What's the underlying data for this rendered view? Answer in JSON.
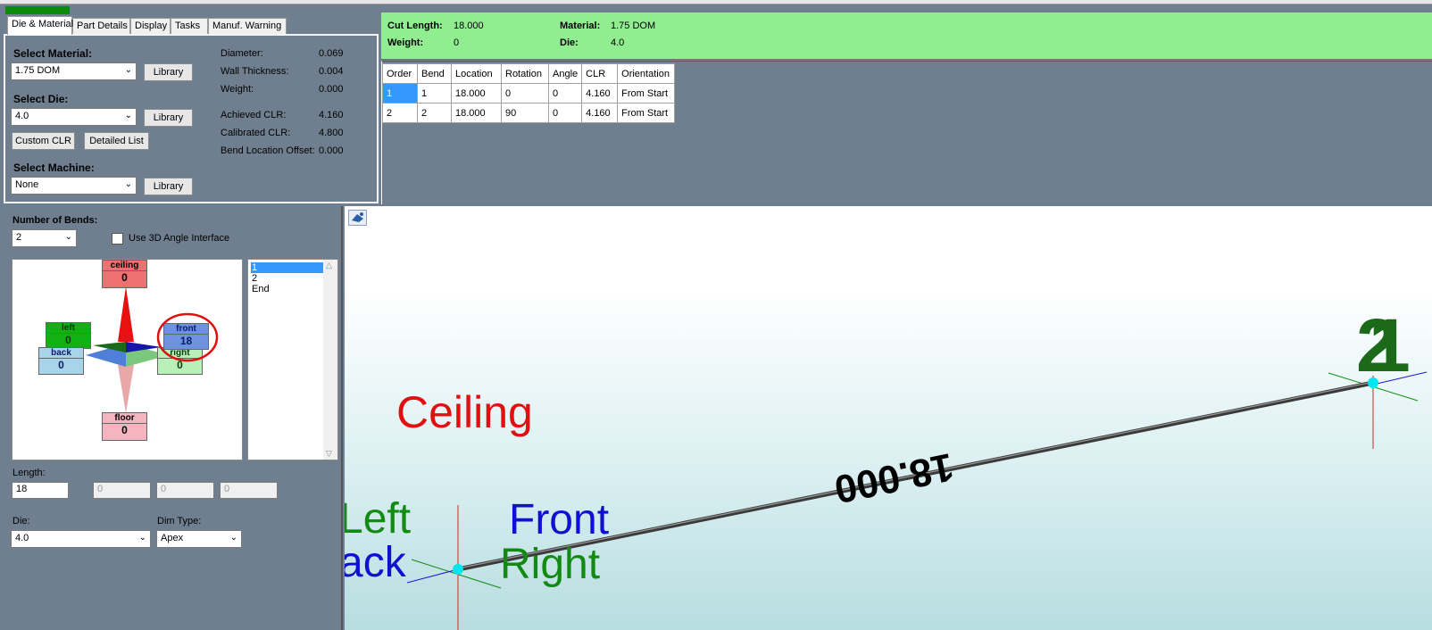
{
  "tabs": [
    {
      "label": "Die & Material"
    },
    {
      "label": "Part Details"
    },
    {
      "label": "Display"
    },
    {
      "label": "Tasks"
    },
    {
      "label": "Manuf. Warning"
    }
  ],
  "material": {
    "select_material_label": "Select Material:",
    "material_value": "1.75 DOM",
    "library_label": "Library",
    "select_die_label": "Select Die:",
    "die_value": "4.0",
    "custom_clr_label": "Custom CLR",
    "detailed_list_label": "Detailed List",
    "select_machine_label": "Select Machine:",
    "machine_value": "None"
  },
  "properties": [
    {
      "label": "Diameter:",
      "value": "0.069"
    },
    {
      "label": "Wall Thickness:",
      "value": "0.004"
    },
    {
      "label": "Weight:",
      "value": "0.000"
    },
    {
      "label": "Achieved CLR:",
      "value": "4.160"
    },
    {
      "label": "Calibrated CLR:",
      "value": "4.800"
    },
    {
      "label": "Bend Location Offset:",
      "value": "0.000"
    }
  ],
  "info": {
    "cut_length_label": "Cut Length:",
    "cut_length_value": "18.000",
    "weight_label": "Weight:",
    "weight_value": "0",
    "material_label": "Material:",
    "material_value": "1.75 DOM",
    "die_label": "Die:",
    "die_value": "4.0"
  },
  "table": {
    "headers": [
      "Order",
      "Bend",
      "Location",
      "Rotation",
      "Angle",
      "CLR",
      "Orientation"
    ],
    "rows": [
      [
        "1",
        "1",
        "18.000",
        "0",
        "0",
        "4.160",
        "From Start"
      ],
      [
        "2",
        "2",
        "18.000",
        "90",
        "0",
        "4.160",
        "From Start"
      ]
    ]
  },
  "bends_panel": {
    "number_of_bends_label": "Number of Bends:",
    "number_of_bends_value": "2",
    "use_3d_label": "Use 3D Angle Interface",
    "compass": {
      "ceiling": {
        "label": "ceiling",
        "value": "0"
      },
      "left": {
        "label": "left",
        "value": "0"
      },
      "front": {
        "label": "front",
        "value": "18"
      },
      "back": {
        "label": "back",
        "value": "0"
      },
      "right": {
        "label": "right",
        "value": "0"
      },
      "floor": {
        "label": "floor",
        "value": "0"
      }
    },
    "list_items": [
      "1",
      "2",
      "End"
    ],
    "length_label": "Length:",
    "length_values": [
      "18",
      "0",
      "0",
      "0"
    ],
    "die_label": "Die:",
    "die_value": "4.0",
    "dim_type_label": "Dim Type:",
    "dim_type_value": "Apex"
  },
  "viewport": {
    "ceiling_label": "Ceiling",
    "left_label": "Left",
    "back_label": "ack",
    "front_label": "Front",
    "right_label": "Right",
    "dimension_label": "18.000",
    "node_label_a": "2",
    "node_label_b": "1"
  },
  "colors": {
    "info_bar": "#90ee90",
    "panel_bg": "#6f7f8f",
    "selection": "#3399ff",
    "ceiling": "#e01010",
    "front": "#1010d0",
    "left_right": "#138a13",
    "node": "#00e5ee"
  }
}
